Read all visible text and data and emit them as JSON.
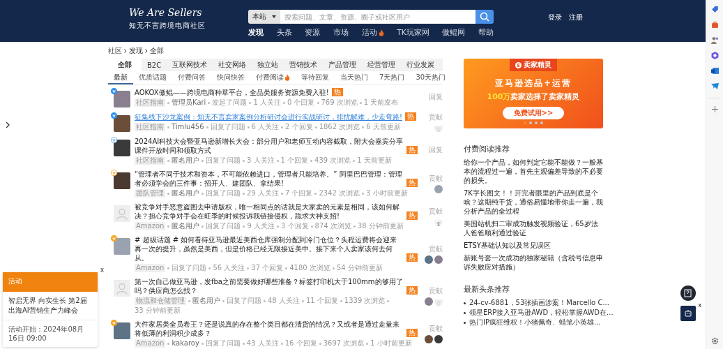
{
  "header": {
    "logo": "We Are Sellers",
    "tagline": "知无不言跨境电商社区",
    "search": {
      "scope": "本站",
      "placeholder": "搜索问题、文章、资源、圈子或社区用户"
    },
    "account": [
      "登录",
      "注册"
    ],
    "nav": [
      {
        "label": "发现",
        "selected": true,
        "fire": false
      },
      {
        "label": "头条",
        "selected": false,
        "fire": false
      },
      {
        "label": "资源",
        "selected": false,
        "fire": false
      },
      {
        "label": "市场",
        "selected": false,
        "fire": false
      },
      {
        "label": "活动",
        "selected": false,
        "fire": true
      },
      {
        "label": "TK玩家网",
        "selected": false,
        "fire": false
      },
      {
        "label": "傲鲲网",
        "selected": false,
        "fire": false
      },
      {
        "label": "帮助",
        "selected": false,
        "fire": false
      }
    ]
  },
  "breadcrumb": [
    "社区",
    "发现",
    "全部"
  ],
  "category_tabs": [
    {
      "label": "全部",
      "selected": true
    },
    {
      "label": "B2C",
      "selected": false
    },
    {
      "label": "互联网技术",
      "selected": false
    },
    {
      "label": "社交网络",
      "selected": false
    },
    {
      "label": "独立站",
      "selected": false
    },
    {
      "label": "营销技术",
      "selected": false
    },
    {
      "label": "产品管理",
      "selected": false
    },
    {
      "label": "经营管理",
      "selected": false
    },
    {
      "label": "行业发展",
      "selected": false
    }
  ],
  "sort_tabs": [
    {
      "label": "最新",
      "selected": true,
      "fire": false
    },
    {
      "label": "优质话题",
      "selected": false,
      "fire": false
    },
    {
      "label": "付费问答",
      "selected": false,
      "fire": false
    },
    {
      "label": "快问快答",
      "selected": false,
      "fire": false
    },
    {
      "label": "付费阅读",
      "selected": false,
      "fire": true
    },
    {
      "label": "等待回复",
      "selected": false,
      "fire": false
    },
    {
      "label": "当天热门",
      "selected": false,
      "fire": false
    },
    {
      "label": "7天热门",
      "selected": false,
      "fire": false
    },
    {
      "label": "30天热门",
      "selected": false,
      "fire": false
    }
  ],
  "questions": [
    {
      "avatar": {
        "kind": "photo"
      },
      "badge": {
        "kind": "blue"
      },
      "title": "AOKOX傲鲲——跨境电商种草平台，全品类服务资源免费入驻!",
      "highlighted": false,
      "hot": "热",
      "tag": "社区指南",
      "user": "管理员Kari",
      "action": "发起了问题",
      "stats": [
        "1 人关注",
        "0 个回复",
        "769 次浏览",
        "1 天前发布"
      ],
      "side_label": "回复"
    },
    {
      "avatar": {
        "kind": "photo"
      },
      "badge": {
        "kind": "blue"
      },
      "title": "征集线下沙龙案例：知无不言卖家案例分析研讨会进行实战研讨，排忧解难，少走弯路!",
      "highlighted": true,
      "hot": "热",
      "tag": "社区指南",
      "user": "Timlu456",
      "action": "回复了问题",
      "stats": [
        "6 人关注",
        "2 个回复",
        "1862 次浏览",
        "6 天前更新"
      ],
      "side_label": "贡献",
      "contributors": [
        {
          "kind": "default"
        }
      ]
    },
    {
      "avatar": {
        "kind": "photo"
      },
      "badge": {
        "kind": "blue-outline"
      },
      "title": "2024AI科技大会暨亚马逊新增长大会：部分用户和老师互动内容截取，附大会嘉宾分享课件开放时间和领取方式",
      "highlighted": false,
      "hot": "热",
      "tag": "社区指南",
      "user": "匿名用户",
      "action": "回复了问题",
      "stats": [
        "3 人关注",
        "1 个回复",
        "439 次浏览",
        "1 天前更新"
      ],
      "side_label": "回复"
    },
    {
      "avatar": {
        "kind": "photo"
      },
      "badge": {
        "kind": "orange-outline"
      },
      "title": "“管理者不同于技术和资本，不可能依赖进口，管理者只能培养。” 阿里巴巴管理：管理者必须学会的三件事：招开人、建团队、拿结果!",
      "highlighted": false,
      "hot": "热",
      "tag": "团队管理",
      "user": "匿名用户",
      "action": "回复了问题",
      "stats": [
        "29 人关注",
        "7 个回复",
        "2342 次浏览",
        "3 小时前更新"
      ],
      "side_label": "贡献",
      "contributors": [
        {
          "kind": "photo"
        }
      ]
    },
    {
      "avatar": {
        "kind": "default"
      },
      "title": "被竞争对手恶意盗图去申请版权，唯一相同点的话就是大家卖的元素是相同，该如何解决？担心竞争对手会在旺季的时候投诉我链接侵权，跪求大神支招!",
      "highlighted": false,
      "hot": "热",
      "tag": "Amazon",
      "user": "匿名用户",
      "action": "回复了问题",
      "stats": [
        "9 人关注",
        "3 个回复",
        "874 次浏览",
        "38 分钟前更新"
      ],
      "side_label": "贡献",
      "contributors": [
        {
          "kind": "sketch"
        }
      ]
    },
    {
      "avatar": {
        "kind": "photo"
      },
      "badge": {
        "kind": "orange"
      },
      "title": "# 超级话题 # 如何看待亚马逊最近美西仓库强制分配到冷门仓位？头程运费将会迎来再一次的提升，虽然是美西，但是价格已经无限接近美中。接下来个人卖家该何去何从。",
      "highlighted": false,
      "hot": "热",
      "tag": "Amazon",
      "action": "回复了问题",
      "stats": [
        "56 人关注",
        "37 个回复",
        "4180 次浏览",
        "54 分钟前更新"
      ],
      "side_label": "贡献",
      "contributors": [
        {
          "kind": "photo"
        },
        {
          "kind": "photo"
        }
      ]
    },
    {
      "avatar": {
        "kind": "default"
      },
      "title": "第一次自己做亚马逊，发fba之前需要做好哪些准备？标签打印机大于100mm的够用了吗？供应商怎么找？",
      "highlighted": false,
      "hot": "热",
      "tag": "物流和仓储管理",
      "user": "匿名用户",
      "action": "回复了问题",
      "stats": [
        "48 人关注",
        "11 个回复",
        "1339 次浏览",
        "33 分钟前更新"
      ],
      "side_label": "贡献",
      "contributors": [
        {
          "kind": "photo"
        },
        {
          "kind": "default"
        }
      ]
    },
    {
      "avatar": {
        "kind": "photo"
      },
      "badge": {
        "kind": "orange"
      },
      "title": "大件家居类全员卷王？还是说真的存在整个类目都在清货的情况？又或者是通过走量来将低薄的利润积少成多？",
      "highlighted": false,
      "hot": "热",
      "tag": "Amazon",
      "user": "kakaroy",
      "action": "回复了问题",
      "stats": [
        "43 人关注",
        "16 个回复",
        "3697 次浏览",
        "1 小时前更新"
      ],
      "side_label": "贡献",
      "contributors": [
        {
          "kind": "photo"
        },
        {
          "kind": "photo"
        }
      ]
    }
  ],
  "ad": {
    "brand": "卖家精灵",
    "headline": "亚马逊选品+运营",
    "subline": "**100万**卖家选择了卖家精灵",
    "button": "免费试用>>",
    "dots": [
      {
        "selected": true
      },
      {
        "selected": false
      },
      {
        "selected": false
      },
      {
        "selected": false
      }
    ]
  },
  "paid_reading": {
    "title": "付费阅读推荐",
    "items": [
      "给你一个产品，如何判定它能不能做？一般基本的流程过一遍，首先主观偏差导致的不必要的损失。",
      "7K字长图文！！开完者眼里的产品到底是个啥？这期纯干货，通俗易懂地带你走一遍，我分析产品的全过程",
      "美国站机扫二审成功触发视频验证，65岁法人爸爸顺利通过验证",
      "ETSY基础认知以及常见误区",
      "新账号套一次成功的独家秘籍（含税号信息申诉失败应对措施）"
    ]
  },
  "headlines": {
    "title": "最新头条推荐",
    "items": [
      "24-cv-6881，53张插画涉案！Marcello C...",
      "领星ERP接入亚马逊AWD，轻松掌握AWD在...",
      "热门IP疯狂维权！小猪佩奇、蜡笔小英雄..."
    ]
  },
  "event_popup": {
    "close": "x",
    "label": "活动",
    "title": "智启无界 向实生长 第2届出海AI营销生产力峰会",
    "start": "活动开始：2024年08月16日 09:00"
  },
  "robot_close": "x"
}
